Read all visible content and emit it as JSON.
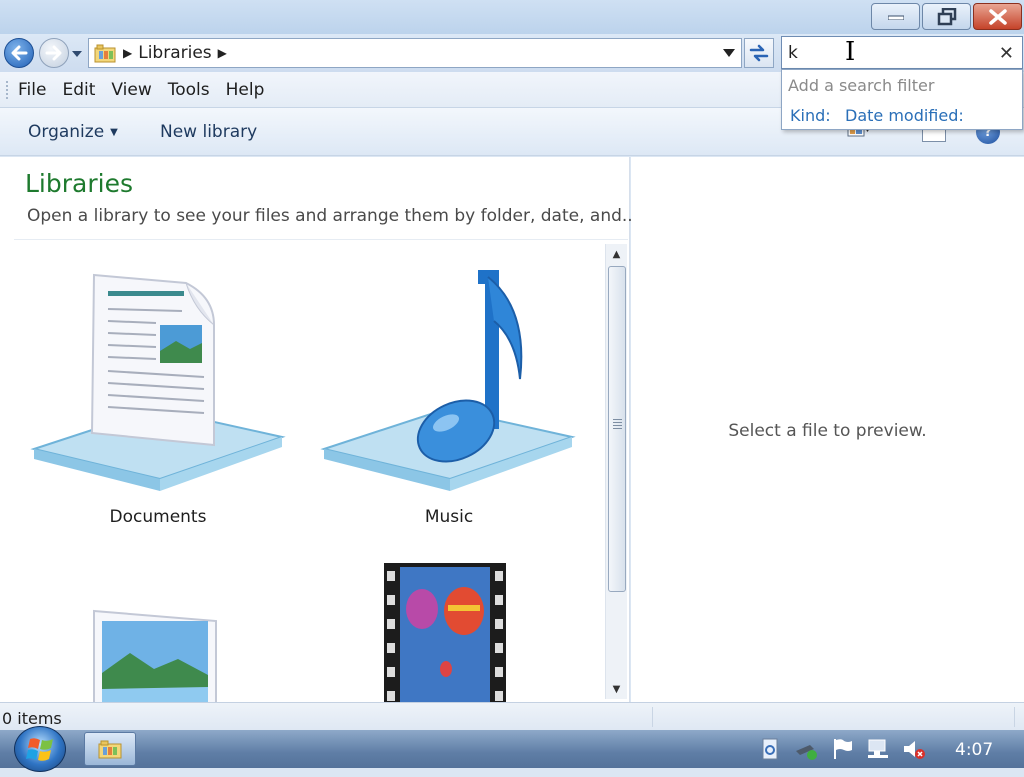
{
  "window": {
    "min_icon": "minimize-icon",
    "max_icon": "restore-icon",
    "close_icon": "close-icon"
  },
  "nav": {
    "address": "Libraries",
    "search_value": "k",
    "search_clear": "✕"
  },
  "search_filter": {
    "hint": "Add a search filter",
    "kind": "Kind:",
    "date_modified": "Date modified:"
  },
  "menu": {
    "items": [
      "File",
      "Edit",
      "View",
      "Tools",
      "Help"
    ]
  },
  "commands": {
    "organize": "Organize",
    "new_library": "New library"
  },
  "content": {
    "title": "Libraries",
    "subtitle": "Open a library to see your files and arrange them by folder, date, and...",
    "libraries": [
      {
        "label": "Documents"
      },
      {
        "label": "Music"
      },
      {
        "label": "Pictures"
      },
      {
        "label": "Videos"
      }
    ]
  },
  "preview": {
    "message": "Select a file to preview."
  },
  "status": {
    "items_text": "0 items"
  },
  "taskbar": {
    "clock": "4:07"
  },
  "colors": {
    "title_green": "#1e7a2e",
    "link_blue": "#2a6fb8"
  }
}
